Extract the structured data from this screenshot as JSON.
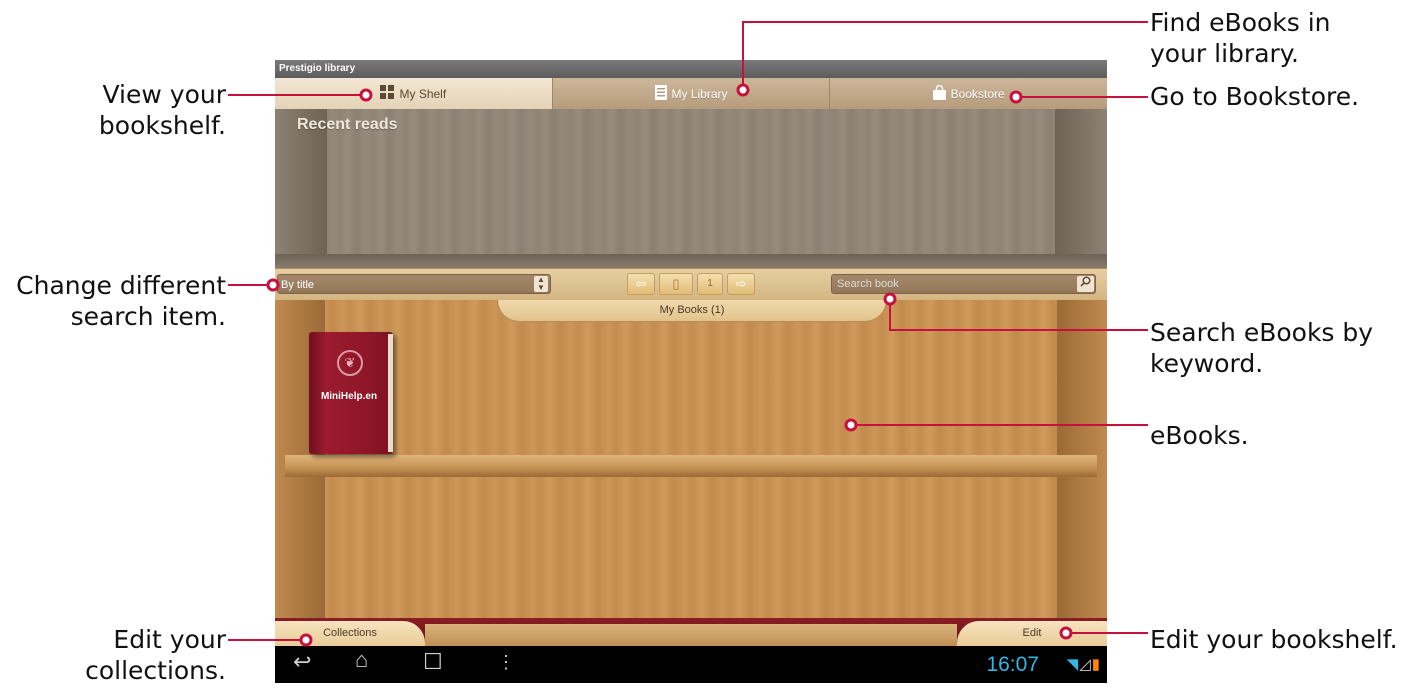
{
  "app": {
    "title": "Prestigio library"
  },
  "tabs": [
    {
      "label": "My Shelf",
      "icon": "grid-icon",
      "active": true
    },
    {
      "label": "My Library",
      "icon": "list-icon",
      "active": false
    },
    {
      "label": "Bookstore",
      "icon": "bag-icon",
      "active": false
    }
  ],
  "recent": {
    "title": "Recent reads"
  },
  "search_bar": {
    "sort_value": "By title",
    "page_number": "1",
    "search_placeholder": "Search book"
  },
  "shelf": {
    "label": "My Books (1)",
    "books": [
      {
        "title": "MiniHelp.en",
        "color": "#8e1627"
      }
    ]
  },
  "bottom": {
    "collections_label": "Collections",
    "edit_label": "Edit"
  },
  "status": {
    "clock": "16:07"
  },
  "annotations": {
    "view_shelf": [
      "View your",
      "bookshelf."
    ],
    "find_library": [
      "Find eBooks in",
      "your library."
    ],
    "bookstore": "Go to Bookstore.",
    "change_search": [
      "Change different",
      "search item."
    ],
    "search_keyword": [
      "Search eBooks by",
      "keyword."
    ],
    "ebooks": "eBooks.",
    "edit_collections": [
      "Edit your",
      "collections."
    ],
    "edit_shelf": "Edit your bookshelf."
  },
  "colors": {
    "callout": "#c8103c",
    "shelf_wood": "#c58e50",
    "clock": "#33b5e5"
  }
}
